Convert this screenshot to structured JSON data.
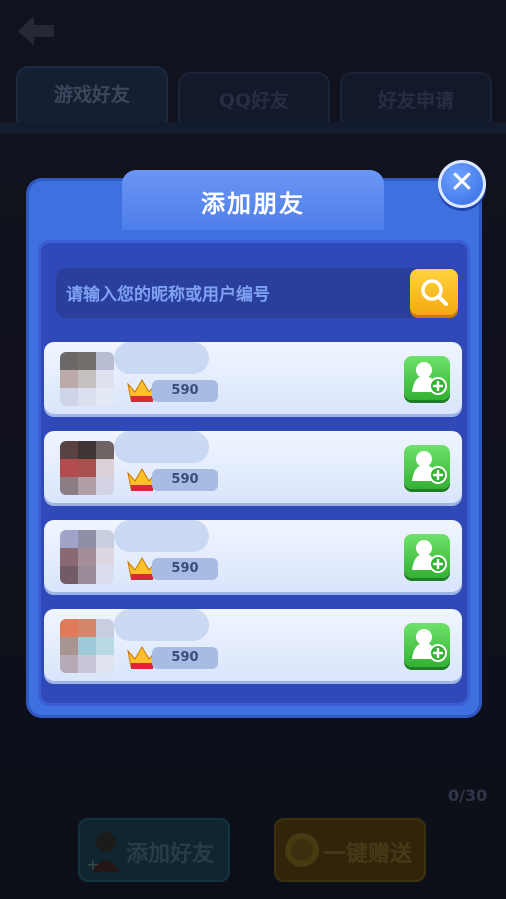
{
  "tabs": [
    {
      "label": "游戏好友"
    },
    {
      "label": "QQ好友"
    },
    {
      "label": "好友申请"
    }
  ],
  "modal": {
    "title": "添加朋友",
    "search_placeholder": "请输入您的昵称或用户编号"
  },
  "friends": [
    {
      "score": "590"
    },
    {
      "score": "590"
    },
    {
      "score": "590"
    },
    {
      "score": "590"
    }
  ],
  "footer": {
    "count": "0/30",
    "add_friend_label": "添加好友",
    "gift_label": "一键赠送"
  },
  "colors": {
    "modal_blue": "#3f70e0",
    "search_yellow": "#f5a812",
    "add_green": "#33b133"
  }
}
